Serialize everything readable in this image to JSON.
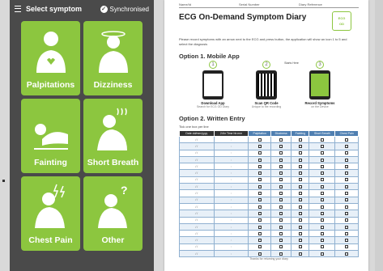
{
  "phone": {
    "title": "Select symptom",
    "sync_label": "Synchronised",
    "tiles": [
      {
        "label": "Palpitations",
        "icon": "palpitations-icon"
      },
      {
        "label": "Dizziness",
        "icon": "dizziness-icon"
      },
      {
        "label": "Fainting",
        "icon": "fainting-icon"
      },
      {
        "label": "Short Breath",
        "icon": "short-breath-icon"
      },
      {
        "label": "Chest Pain",
        "icon": "chest-pain-icon"
      },
      {
        "label": "Other",
        "icon": "other-icon"
      }
    ],
    "colors": {
      "tile": "#8cc63f",
      "bg": "#4a4a4a"
    }
  },
  "diary": {
    "fields": [
      "Name/Id",
      "Serial Number",
      "Diary Reference"
    ],
    "title": "ECG On-Demand Symptom Diary",
    "logo": [
      "ECG",
      "OD"
    ],
    "intro": "Please record symptoms with an arrow next to the ECG and press button, the application will show an icon 1 to 5 and select the diagnosis",
    "option1": "Option 1. Mobile App",
    "steps": [
      {
        "num": "1",
        "caption": "Download App",
        "sub": "Search for ECG OD Diary"
      },
      {
        "num": "2",
        "caption": "Scan QR Code",
        "sub": "Unique to the recording",
        "note": "Starts Here"
      },
      {
        "num": "3",
        "caption": "Record Symptoms",
        "sub": "on the Device"
      }
    ],
    "option2": "Option 2. Written Entry",
    "tick_hint": "Tick one box per line",
    "columns": [
      "Date dd/mm/yyyy",
      "24hr Time hh:mm",
      "Palpitation",
      "Dizziness",
      "Fainting",
      "Short Breath",
      "Chest Pain"
    ],
    "row_count": 18,
    "footer": "Thanks for returning your diary"
  }
}
